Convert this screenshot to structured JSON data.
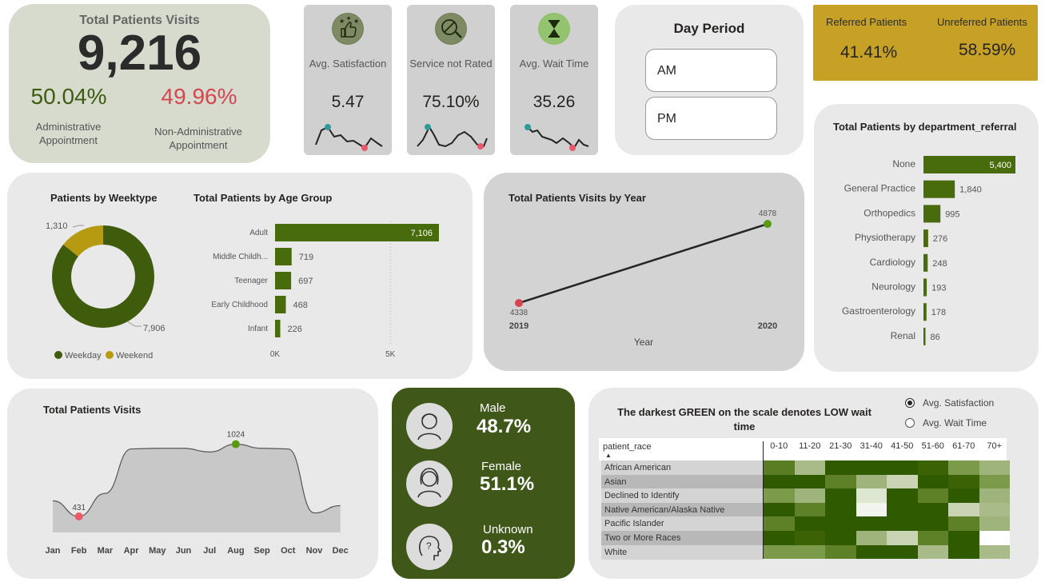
{
  "kpi": {
    "title": "Total Patients Visits",
    "total": "9,216",
    "admin_pct": "50.04%",
    "admin_label": "Administrative Appointment",
    "nonadmin_pct": "49.96%",
    "nonadmin_label": "Non-Administrative Appointment",
    "colors": {
      "admin": "#3f5b12",
      "nonadmin": "#d64550"
    }
  },
  "mini_kpis": [
    {
      "label": "Avg. Satisfaction",
      "value": "5.47",
      "icon": "thumbs-up-stars-icon"
    },
    {
      "label": "Service not Rated",
      "value": "75.10%",
      "icon": "no-rating-icon"
    },
    {
      "label": "Avg. Wait Time",
      "value": "35.26",
      "icon": "hourglass-icon"
    }
  ],
  "day_period": {
    "title": "Day Period",
    "options": [
      "AM",
      "PM"
    ]
  },
  "referral": {
    "referred_label": "Referred Patients",
    "referred_value": "41.41%",
    "unreferred_label": "Unreferred Patients",
    "unreferred_value": "58.59%"
  },
  "dept_chart": {
    "title": "Total Patients by department_referral",
    "categories": [
      "None",
      "General Practice",
      "Orthopedics",
      "Physiotherapy",
      "Cardiology",
      "Neurology",
      "Gastroenterology",
      "Renal"
    ],
    "values": [
      5400,
      1840,
      995,
      276,
      248,
      193,
      178,
      86
    ],
    "labels": [
      "5,400",
      "1,840",
      "995",
      "276",
      "248",
      "193",
      "178",
      "86"
    ],
    "color": "#486b0b"
  },
  "weektype_chart": {
    "title": "Patients by Weektype",
    "type": "pie",
    "categories": [
      "Weekday",
      "Weekend"
    ],
    "values": [
      7906,
      1310
    ],
    "labels": [
      "7,906",
      "1,310"
    ],
    "colors": [
      "#3f5b0c",
      "#b59a12"
    ]
  },
  "age_chart": {
    "title": "Total Patients by Age Group",
    "categories": [
      "Adult",
      "Middle Childh...",
      "Teenager",
      "Early Childhood",
      "Infant"
    ],
    "values": [
      7106,
      719,
      697,
      468,
      226
    ],
    "labels": [
      "7,106",
      "719",
      "697",
      "468",
      "226"
    ],
    "ticks": [
      "0K",
      "5K"
    ],
    "color": "#486b0b"
  },
  "year_chart": {
    "title": "Total Patients Visits by Year",
    "x": [
      "2019",
      "2020"
    ],
    "values": [
      4338,
      4878
    ],
    "labels": [
      "4338",
      "4878"
    ],
    "xlabel": "Year",
    "colors": {
      "min": "#d64550",
      "max": "#5a9a12"
    }
  },
  "month_chart": {
    "title": "Total Patients Visits",
    "categories": [
      "Jan",
      "Feb",
      "Mar",
      "Apr",
      "May",
      "Jun",
      "Jul",
      "Aug",
      "Sep",
      "Oct",
      "Nov",
      "Dec"
    ],
    "values": [
      560,
      431,
      620,
      985,
      990,
      990,
      960,
      1024,
      990,
      985,
      460,
      520
    ],
    "min_label": "431",
    "max_label": "1024"
  },
  "gender": [
    {
      "label": "Male",
      "value": "48.7%",
      "icon": "male-person-icon"
    },
    {
      "label": "Female",
      "value": "51.1%",
      "icon": "female-person-icon"
    },
    {
      "label": "Unknown",
      "value": "0.3%",
      "icon": "unknown-person-icon"
    }
  ],
  "heatmap": {
    "title": "The darkest GREEN on the scale denotes LOW wait time",
    "radio": {
      "options": [
        "Avg. Satisfaction",
        "Avg. Wait Time"
      ],
      "selected": "Avg. Satisfaction"
    },
    "row_header": "patient_race",
    "columns": [
      "0-10",
      "11-20",
      "21-30",
      "31-40",
      "41-50",
      "51-60",
      "61-70",
      "70+"
    ],
    "rows": [
      "African American",
      "Asian",
      "Declined to Identify",
      "Native American/Alaska Native",
      "Pacific Islander",
      "Two or More Races",
      "White"
    ],
    "colors": [
      [
        "#5a7d24",
        "#a8bb88",
        "#2f5a00",
        "#2f5a00",
        "#2f5a00",
        "#3b6306",
        "#7b9a4a",
        "#9fb47c"
      ],
      [
        "#2f5a00",
        "#2f5a00",
        "#5e8128",
        "#9fb47c",
        "#c8d4b4",
        "#2f5a00",
        "#3b6306",
        "#7b9a4a"
      ],
      [
        "#7b9a4a",
        "#9fb47c",
        "#2f5a00",
        "#dde6d0",
        "#2f5a00",
        "#5e8128",
        "#2f5a00",
        "#9fb47c"
      ],
      [
        "#2f5a00",
        "#5e8128",
        "#2f5a00",
        "#f2f5ee",
        "#2f5a00",
        "#2f5a00",
        "#c8d4b4",
        "#a8bb88"
      ],
      [
        "#5e8128",
        "#2f5a00",
        "#2f5a00",
        "#2f5a00",
        "#2f5a00",
        "#2f5a00",
        "#5e8128",
        "#9fb47c"
      ],
      [
        "#2f5a00",
        "#3b6306",
        "#2f5a00",
        "#9fb47c",
        "#c8d4b4",
        "#5e8128",
        "#2f5a00",
        "#ffffff"
      ],
      [
        "#7b9a4a",
        "#7b9a4a",
        "#5e8128",
        "#2f5a00",
        "#2f5a00",
        "#a8bb88",
        "#2f5a00",
        "#a8bb88"
      ]
    ]
  }
}
